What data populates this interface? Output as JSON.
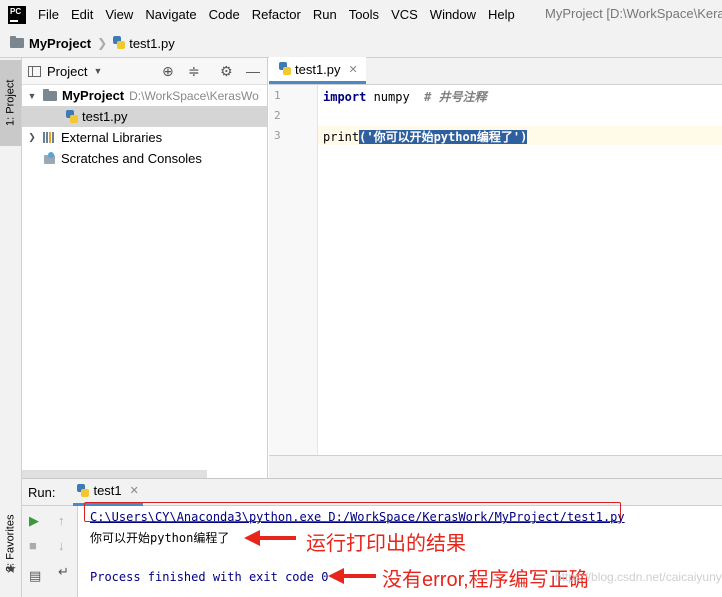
{
  "app": {
    "logo_text": "PC",
    "menu": [
      "File",
      "Edit",
      "View",
      "Navigate",
      "Code",
      "Refactor",
      "Run",
      "Tools",
      "VCS",
      "Window",
      "Help"
    ],
    "window_title": "MyProject [D:\\WorkSpace\\Kera"
  },
  "breadcrumb": {
    "project": "MyProject",
    "file": "test1.py"
  },
  "left_strip": {
    "project_tab": "1: Project",
    "favorites_tab": "2: Favorites"
  },
  "project_panel": {
    "title": "Project",
    "tree": [
      {
        "label": "MyProject",
        "path": "D:\\WorkSpace\\KerasWo"
      },
      {
        "label": "test1.py"
      },
      {
        "label": "External Libraries"
      },
      {
        "label": "Scratches and Consoles"
      }
    ]
  },
  "editor": {
    "tab": "test1.py",
    "line_numbers": [
      "1",
      "2",
      "3"
    ],
    "line1": {
      "keyword": "import",
      "rest": " numpy  ",
      "comment": "# 井号注释"
    },
    "line3": {
      "prefix": "print",
      "selected": "('你可以开始python编程了')"
    }
  },
  "run_panel": {
    "label": "Run:",
    "tab": "test1",
    "command": "C:\\Users\\CY\\Anaconda3\\python.exe D:/WorkSpace/KerasWork/MyProject/test1.py",
    "output": "你可以开始python编程了",
    "finish": "Process finished with exit code 0"
  },
  "annotations": {
    "output_note": "运行打印出的结果",
    "finish_note": "没有error,程序编写正确"
  },
  "watermark": "https://blog.csdn.net/caicaiyunyun",
  "colors": {
    "accent": "#4a88c7",
    "annotation": "#e8251b",
    "selection": "#2e5f9e"
  }
}
